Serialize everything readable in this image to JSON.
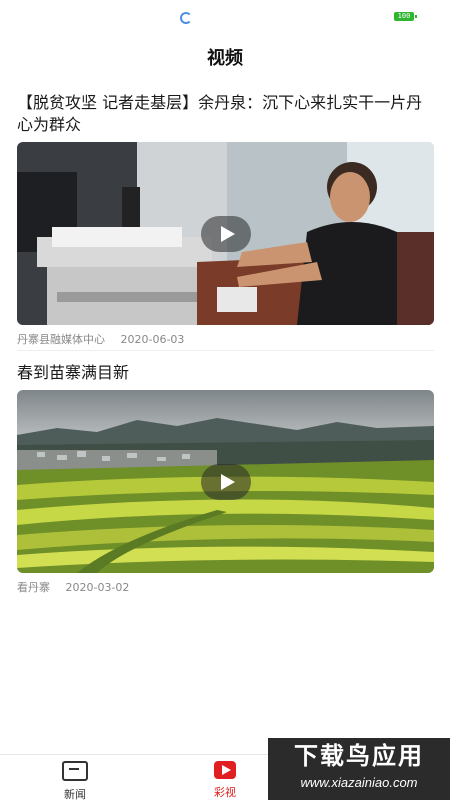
{
  "status": {
    "battery": "100",
    "battery_color": "#2fb52f"
  },
  "header": {
    "title": "视频"
  },
  "articles": [
    {
      "title": "【脱贫攻坚 记者走基层】余丹泉：沉下心来扎实干一片丹心为群众",
      "source": "丹寨县融媒体中心",
      "date": "2020-06-03",
      "thumbnail": "office-man-at-desk"
    },
    {
      "title": "春到苗寨满目新",
      "source": "看丹寨",
      "date": "2020-03-02",
      "thumbnail": "terraced-fields-village"
    }
  ],
  "tabbar": {
    "items": [
      {
        "label": "新闻",
        "icon": "news-icon"
      },
      {
        "label": "彩视",
        "icon": "video-icon",
        "active": true
      }
    ],
    "accent": "#e02020"
  },
  "watermark": {
    "main": "下载鸟应用",
    "sub": "www.xiazainiao.com"
  }
}
